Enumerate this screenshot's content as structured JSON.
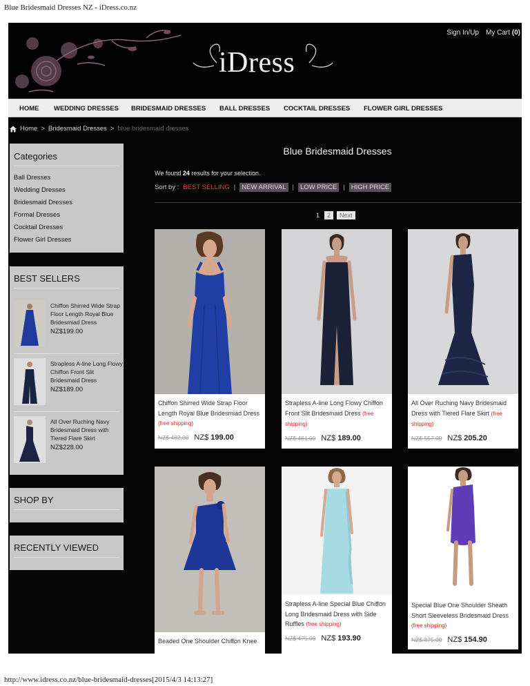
{
  "document": {
    "title": "Blue Bridesmaid Dresses NZ - iDress.co.nz",
    "footer": "http://www.idress.co.nz/blue-bridesmaid-dresses[2015/4/3 14:13:27]"
  },
  "header": {
    "logo": "iDress",
    "sign_in": "Sign In/Up",
    "cart_label": "My Cart",
    "cart_count": "(0)"
  },
  "nav": {
    "items": [
      "HOME",
      "WEDDING DRESSES",
      "BRIDESMAID DRESSES",
      "BALL DRESSES",
      "COCKTAIL DRESSES",
      "FLOWER GIRL DRESSES"
    ]
  },
  "breadcrumb": {
    "home": "Home",
    "sep": ">",
    "parent": "Bridesmaid Dresses",
    "current": "blue bridesmaid dresses"
  },
  "sidebar": {
    "categories_title": "Categories",
    "categories": [
      "Ball Dresses",
      "Wedding Dresses",
      "Bridesmaid Dresses",
      "Formal Dresses",
      "Cocktail Dresses",
      "Flower Girl Dresses"
    ],
    "best_sellers_title": "BEST SELLERS",
    "best_sellers": [
      {
        "name": "Chiffon Shirred Wide Strap Floor Length Royal Blue Bridesmiad Dress",
        "price": "NZ$199.00",
        "color": "#1e3a9a"
      },
      {
        "name": "Strapless A-line Long Flowy Chiffon Front Slit Bridesmaid Dress",
        "price": "NZ$189.00",
        "color": "#1a2340"
      },
      {
        "name": "All Over Ruching Navy Bridesmaid Dress with Tiered Flare Skirt",
        "price": "NZ$228.00",
        "color": "#1c2442"
      }
    ],
    "shop_by_title": "SHOP BY",
    "recently_viewed_title": "RECENTLY VIEWED"
  },
  "main": {
    "title": "Blue Bridesmaid Dresses",
    "results_prefix": "We found",
    "results_count": "24",
    "results_suffix": "results for your selection.",
    "sort_label": "Sort by :",
    "sort_options": [
      "BEST SELLING",
      "NEW ARRIVAL",
      "LOW PRICE",
      "HIGH PRICE"
    ],
    "sort_divider": "|",
    "pager": {
      "current": "1",
      "page2": "2",
      "next": "Next"
    }
  },
  "products": [
    {
      "name": "Chiffon Shirred Wide Strap Floor Length Royal Blue Bridesmiad Dress",
      "shipping": "(free shipping)",
      "old_price": "NZ$ 482.00",
      "currency": "NZ$",
      "price": "199.00",
      "dress_color": "#1f3fa6",
      "bg": "#b3b0ab"
    },
    {
      "name": "Strapless A-line Long Flowy Chiffon Front Slit Bridesmaid Dress",
      "shipping": "(free shipping)",
      "old_price": "NZ$ 461.00",
      "currency": "NZ$",
      "price": "189.00",
      "dress_color": "#1b2238",
      "bg": "#d4d4d6"
    },
    {
      "name": "All Over Ruching Navy Bridesmaid Dress with Tiered Flare Skirt",
      "shipping": "(free shipping)",
      "old_price": "NZ$ 557.00",
      "currency": "NZ$",
      "price": "205.20",
      "dress_color": "#1d2745",
      "bg": "#d8d8da"
    },
    {
      "name": "Beaded One Shoulder Chiffon Knee",
      "shipping": "",
      "old_price": "",
      "currency": "",
      "price": "",
      "dress_color": "#1e3796",
      "bg": "#c2bfbb"
    },
    {
      "name": "Strapless A-line Special Blue Chiffon Long Bridesmaid Dress with Side Ruffles",
      "shipping": "(free shipping)",
      "old_price": "NZ$ 475.00",
      "currency": "NZ$",
      "price": "193.90",
      "dress_color": "#a6dbe4",
      "bg": "#f2f2f2"
    },
    {
      "name": "Special Blue One Shoulder Sheath Short Sleeveless Bridesmaid Dress",
      "shipping": "(free shipping)",
      "old_price": "NZ$ 375.00",
      "currency": "NZ$",
      "price": "154.90",
      "dress_color": "#5f3db8",
      "bg": "#ffffff"
    }
  ]
}
